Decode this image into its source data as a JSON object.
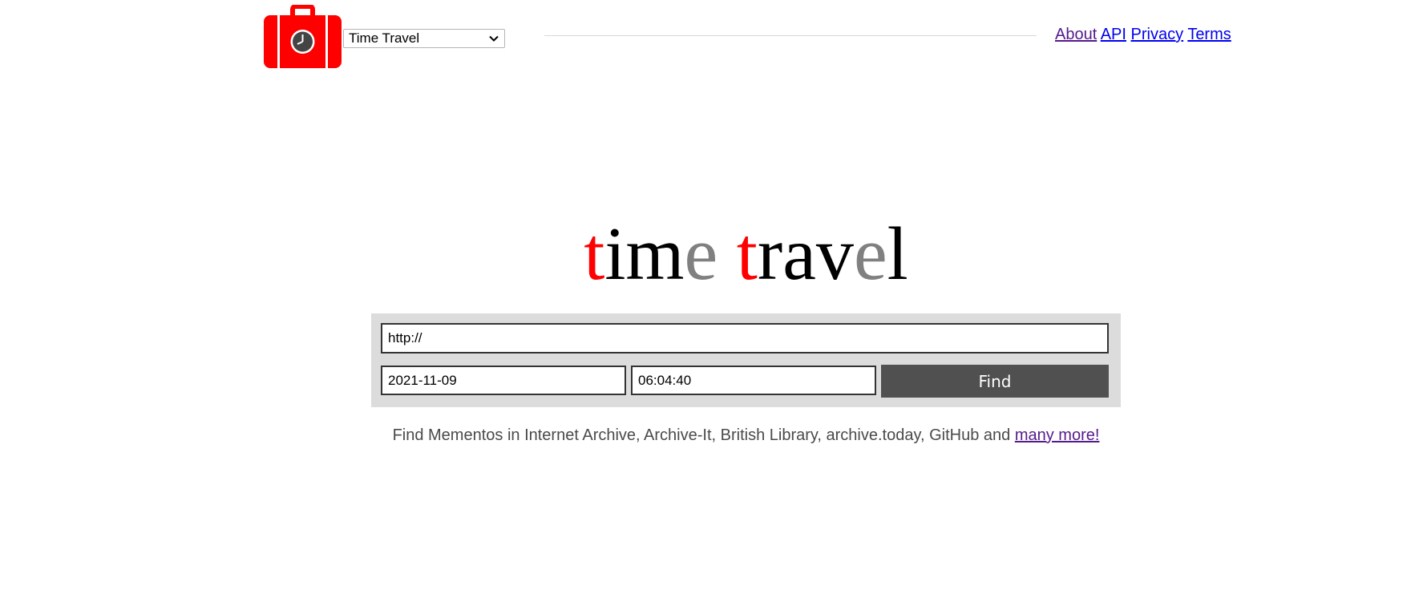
{
  "header": {
    "logo_icon": "suitcase-clock-icon",
    "service_select": {
      "selected": "Time Travel"
    },
    "nav": {
      "about": "About",
      "api": "API",
      "privacy": "Privacy",
      "terms": "Terms"
    }
  },
  "wordmark": {
    "parts": [
      "t",
      "im",
      "e",
      " ",
      "t",
      "rav",
      "e",
      "l"
    ]
  },
  "search": {
    "url_value": "http://",
    "date_value": "2021-11-09",
    "time_value": "06:04:40",
    "find_label": "Find"
  },
  "tagline": {
    "text": "Find Mementos in Internet Archive, Archive-It, British Library, archive.today, GitHub and ",
    "link": "many more!"
  },
  "colors": {
    "brand_red": "#ff0000",
    "button_bg": "#505050",
    "panel_bg": "#dcdcdc",
    "wordmark_grey": "#808080"
  }
}
